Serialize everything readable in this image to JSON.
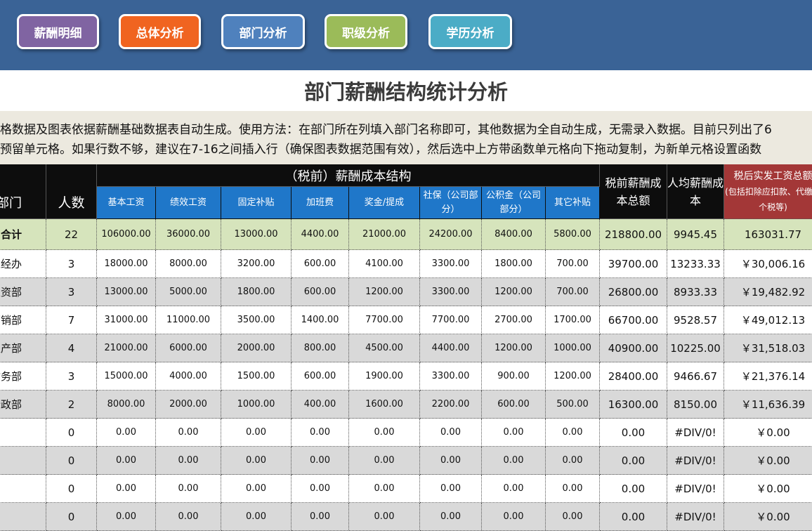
{
  "nav": {
    "buttons": [
      {
        "label": "薪酬明细",
        "color": "#8064a2"
      },
      {
        "label": "总体分析",
        "color": "#f06420"
      },
      {
        "label": "部门分析",
        "color": "#4f81bd"
      },
      {
        "label": "职级分析",
        "color": "#9bbb59"
      },
      {
        "label": "学历分析",
        "color": "#4bacc6"
      }
    ]
  },
  "page_title": "部门薪酬结构统计分析",
  "notes": {
    "line1": "格数据及图表依据薪酬基础数据表自动生成。使用方法：在部门所在列填入部门名称即可，其他数据为全自动生成，无需录入数据。目前只列出了6",
    "line2": "预留单元格。如果行数不够，建议在7-16之间插入行（确保图表数据范围有效），然后选中上方带函数单元格向下拖动复制，为新单元格设置函数"
  },
  "table": {
    "headers": {
      "dept": "部门",
      "count": "人数",
      "group": "（税前）薪酬成本结构",
      "sub": [
        "基本工资",
        "绩效工资",
        "固定补贴",
        "加班费",
        "奖金/提成",
        "社保（公司部分）",
        "公积金（公司部分）",
        "其它补贴"
      ],
      "total": "税前薪酬成本总额",
      "avg": "人均薪酬成本",
      "net": "税后实发工资总额",
      "net_note": "(包括扣除应扣款、代缴、个税等)"
    },
    "rows": [
      [
        "合计",
        "22",
        "106000.00",
        "36000.00",
        "13000.00",
        "4400.00",
        "21000.00",
        "24200.00",
        "8400.00",
        "5800.00",
        "218800.00",
        "9945.45",
        "163031.77"
      ],
      [
        "总经办",
        "3",
        "18000.00",
        "8000.00",
        "3200.00",
        "600.00",
        "4100.00",
        "3300.00",
        "1800.00",
        "700.00",
        "39700.00",
        "13233.33",
        "￥30,006.16"
      ],
      [
        "人资部",
        "3",
        "13000.00",
        "5000.00",
        "1800.00",
        "600.00",
        "1200.00",
        "3300.00",
        "1200.00",
        "700.00",
        "26800.00",
        "8933.33",
        "￥19,482.92"
      ],
      [
        "营销部",
        "7",
        "31000.00",
        "11000.00",
        "3500.00",
        "1400.00",
        "7700.00",
        "7700.00",
        "2700.00",
        "1700.00",
        "66700.00",
        "9528.57",
        "￥49,012.13"
      ],
      [
        "生产部",
        "4",
        "21000.00",
        "6000.00",
        "2000.00",
        "800.00",
        "4500.00",
        "4400.00",
        "1200.00",
        "1000.00",
        "40900.00",
        "10225.00",
        "￥31,518.03"
      ],
      [
        "财务部",
        "3",
        "15000.00",
        "4000.00",
        "1500.00",
        "600.00",
        "1900.00",
        "3300.00",
        "900.00",
        "1200.00",
        "28400.00",
        "9466.67",
        "￥21,376.14"
      ],
      [
        "行政部",
        "2",
        "8000.00",
        "2000.00",
        "1000.00",
        "400.00",
        "1600.00",
        "2200.00",
        "600.00",
        "500.00",
        "16300.00",
        "8150.00",
        "￥11,636.39"
      ],
      [
        "",
        "0",
        "0.00",
        "0.00",
        "0.00",
        "0.00",
        "0.00",
        "0.00",
        "0.00",
        "0.00",
        "0.00",
        "#DIV/0!",
        "￥0.00"
      ],
      [
        "",
        "0",
        "0.00",
        "0.00",
        "0.00",
        "0.00",
        "0.00",
        "0.00",
        "0.00",
        "0.00",
        "0.00",
        "#DIV/0!",
        "￥0.00"
      ],
      [
        "",
        "0",
        "0.00",
        "0.00",
        "0.00",
        "0.00",
        "0.00",
        "0.00",
        "0.00",
        "0.00",
        "0.00",
        "#DIV/0!",
        "￥0.00"
      ],
      [
        "",
        "0",
        "0.00",
        "0.00",
        "0.00",
        "0.00",
        "0.00",
        "0.00",
        "0.00",
        "0.00",
        "0.00",
        "#DIV/0!",
        "￥0.00"
      ]
    ],
    "colors": {
      "header": "#0d0d0d",
      "subheader": "#1f77c9",
      "net_header": "#a33737",
      "total_row": "#d6e4bc",
      "stripe": "#d9d9d9",
      "plain": "#ffffff"
    }
  }
}
